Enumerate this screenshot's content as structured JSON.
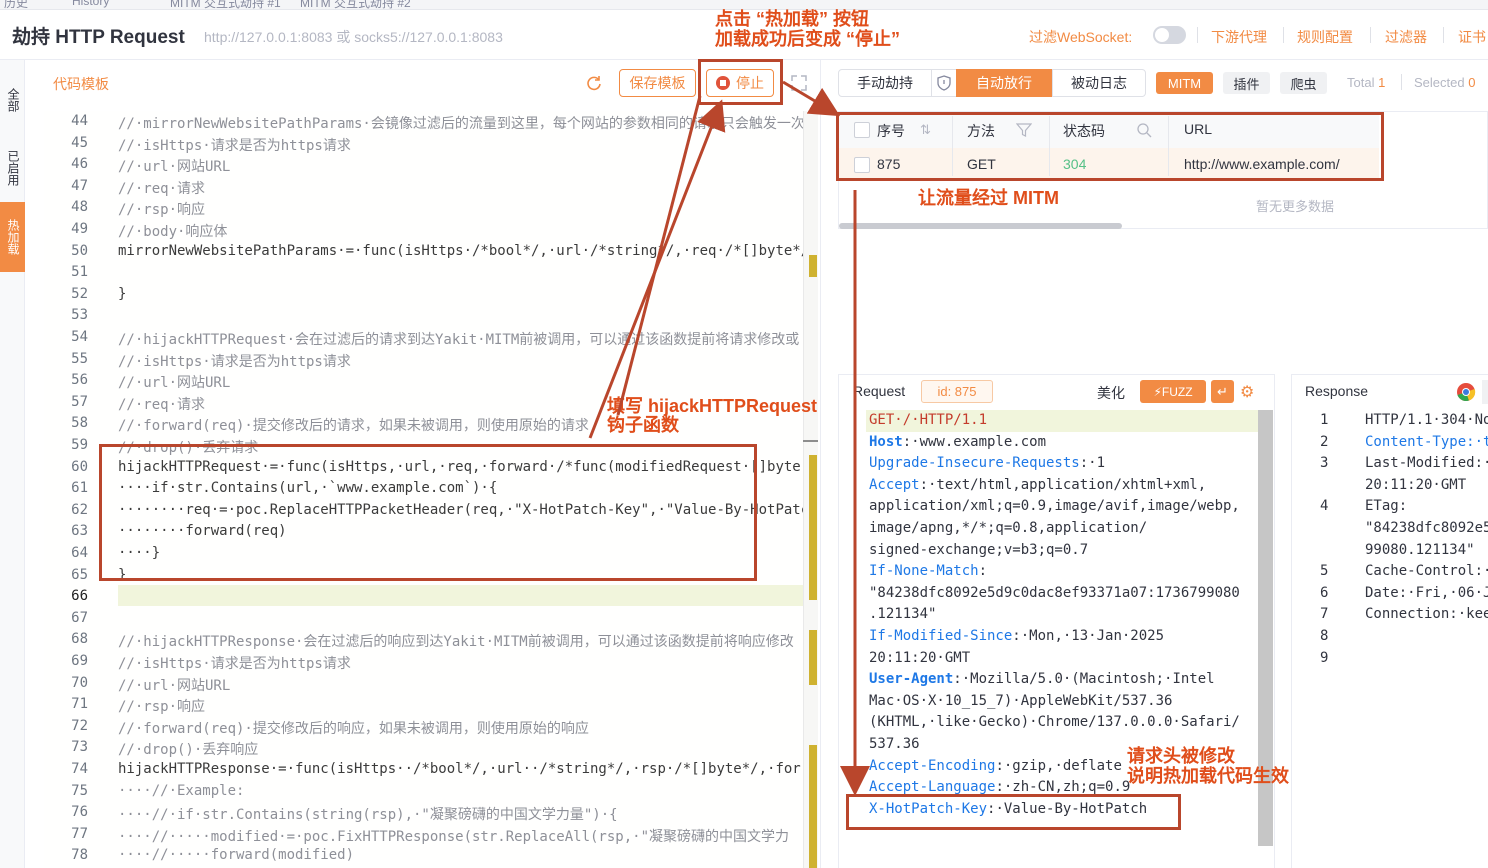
{
  "tabs": [
    "历史",
    "History",
    "MITM 交互式劫持 #1",
    "MITM 交互式劫持 #2"
  ],
  "header": {
    "title": "劫持 HTTP Request",
    "address": "http://127.0.0.1:8083 或 socks5://127.0.0.1:8083",
    "filter_ws_label": "过滤WebSocket:",
    "links": [
      "下游代理",
      "规则配置",
      "过滤器",
      "证书"
    ]
  },
  "side_tabs": [
    "全部",
    "已启用",
    "热加载"
  ],
  "editor": {
    "title": "代码模板",
    "save_label": "保存模板",
    "stop_label": "停止",
    "lines": [
      {
        "n": "44",
        "t": "//·mirrorNewWebsitePathParams·会镜像过滤后的流量到这里，每个网站的参数相同的请求只会触发一次",
        "c": "cmt"
      },
      {
        "n": "45",
        "t": "//·isHttps·请求是否为https请求",
        "c": "cmt"
      },
      {
        "n": "46",
        "t": "//·url·网站URL",
        "c": "cmt"
      },
      {
        "n": "47",
        "t": "//·req·请求",
        "c": "cmt"
      },
      {
        "n": "48",
        "t": "//·rsp·响应",
        "c": "cmt"
      },
      {
        "n": "49",
        "t": "//·body·响应体",
        "c": "cmt"
      },
      {
        "n": "50",
        "t": "mirrorNewWebsitePathParams·=·func(isHttps·/*bool*/,·url·/*string*/,·req·/*[]byte*/",
        "c": "code"
      },
      {
        "n": "51",
        "t": "",
        "c": "code"
      },
      {
        "n": "52",
        "t": "}",
        "c": "code"
      },
      {
        "n": "53",
        "t": "",
        "c": "code"
      },
      {
        "n": "54",
        "t": "//·hijackHTTPRequest·会在过滤后的请求到达Yakit·MITM前被调用，可以通过该函数提前将请求修改或",
        "c": "cmt"
      },
      {
        "n": "55",
        "t": "//·isHttps·请求是否为https请求",
        "c": "cmt"
      },
      {
        "n": "56",
        "t": "//·url·网站URL",
        "c": "cmt"
      },
      {
        "n": "57",
        "t": "//·req·请求",
        "c": "cmt"
      },
      {
        "n": "58",
        "t": "//·forward(req)·提交修改后的请求，如果未被调用，则使用原始的请求",
        "c": "cmt"
      },
      {
        "n": "59",
        "t": "//·drop()·丢弃请求",
        "c": "cmt"
      },
      {
        "n": "60",
        "t": "hijackHTTPRequest·=·func(isHttps,·url,·req,·forward·/*func(modifiedRequest·[]byte",
        "c": "code"
      },
      {
        "n": "61",
        "t": "····if·str.Contains(url,·`www.example.com`)·{",
        "c": "code"
      },
      {
        "n": "62",
        "t": "········req·=·poc.ReplaceHTTPPacketHeader(req,·\"X-HotPatch-Key\",·\"Value-By-HotPatch",
        "c": "code"
      },
      {
        "n": "63",
        "t": "········forward(req)",
        "c": "code"
      },
      {
        "n": "64",
        "t": "····}",
        "c": "code"
      },
      {
        "n": "65",
        "t": "}",
        "c": "code"
      },
      {
        "n": "66",
        "t": "",
        "c": "code"
      },
      {
        "n": "67",
        "t": "",
        "c": "code"
      },
      {
        "n": "68",
        "t": "//·hijackHTTPResponse·会在过滤后的响应到达Yakit·MITM前被调用，可以通过该函数提前将响应修改",
        "c": "cmt"
      },
      {
        "n": "69",
        "t": "//·isHttps·请求是否为https请求",
        "c": "cmt"
      },
      {
        "n": "70",
        "t": "//·url·网站URL",
        "c": "cmt"
      },
      {
        "n": "71",
        "t": "//·rsp·响应",
        "c": "cmt"
      },
      {
        "n": "72",
        "t": "//·forward(req)·提交修改后的响应，如果未被调用，则使用原始的响应",
        "c": "cmt"
      },
      {
        "n": "73",
        "t": "//·drop()·丢弃响应",
        "c": "cmt"
      },
      {
        "n": "74",
        "t": "hijackHTTPResponse·=·func(isHttps··/*bool*/,·url··/*string*/,·rsp·/*[]byte*/,·for",
        "c": "code"
      },
      {
        "n": "75",
        "t": "····//·Example:",
        "c": "cmt"
      },
      {
        "n": "76",
        "t": "····//·if·str.Contains(string(rsp),·\"凝聚磅礴的中国文学力量\")·{",
        "c": "cmt"
      },
      {
        "n": "77",
        "t": "····//·····modified·=·poc.FixHTTPResponse(str.ReplaceAll(rsp,·\"凝聚磅礴的中国文学力",
        "c": "cmt"
      },
      {
        "n": "78",
        "t": "····//·····forward(modified)",
        "c": "cmt"
      }
    ]
  },
  "mitm": {
    "tabs": [
      "手动劫持",
      "自动放行",
      "被动日志"
    ],
    "tags": [
      "MITM",
      "插件",
      "爬虫"
    ],
    "total_label": "Total",
    "total": "1",
    "selected_label": "Selected",
    "selected": "0",
    "columns": [
      "序号",
      "方法",
      "状态码",
      "URL"
    ],
    "rows": [
      {
        "id": "875",
        "method": "GET",
        "status": "304",
        "url": "http://www.example.com/"
      }
    ],
    "empty_text": "暂无更多数据"
  },
  "request": {
    "title": "Request",
    "id_label": "id: 875",
    "beautify_label": "美化",
    "fuzz_label": "FUZZ",
    "lines": [
      {
        "k": "GET·/·HTTP/1.1",
        "v": ""
      },
      {
        "k": "Host",
        "v": ":·www.example.com"
      },
      {
        "k": "Upgrade-Insecure-Requests",
        "v": ":·1"
      },
      {
        "k": "Accept",
        "v": ":·text/html,application/xhtml+xml,"
      },
      {
        "k": "",
        "v": "application/xml;q=0.9,image/avif,image/webp,"
      },
      {
        "k": "",
        "v": "image/apng,*/*;q=0.8,application/"
      },
      {
        "k": "",
        "v": "signed-exchange;v=b3;q=0.7"
      },
      {
        "k": "If-None-Match",
        "v": ":"
      },
      {
        "k": "",
        "v": "\"84238dfc8092e5d9c0dac8ef93371a07:1736799080"
      },
      {
        "k": "",
        "v": ".121134\""
      },
      {
        "k": "If-Modified-Since",
        "v": ":·Mon,·13·Jan·2025"
      },
      {
        "k": "",
        "v": "20:11:20·GMT"
      },
      {
        "k": "User-Agent",
        "v": ":·Mozilla/5.0·(Macintosh;·Intel"
      },
      {
        "k": "",
        "v": "Mac·OS·X·10_15_7)·AppleWebKit/537.36"
      },
      {
        "k": "",
        "v": "(KHTML,·like·Gecko)·Chrome/137.0.0.0·Safari/"
      },
      {
        "k": "",
        "v": "537.36"
      },
      {
        "k": "Accept-Encoding",
        "v": ":·gzip,·deflate"
      },
      {
        "k": "Accept-Language",
        "v": ":·zh-CN,zh;q=0.9"
      },
      {
        "k": "X-HotPatch-Key",
        "v": ":·Value-By-HotPatch"
      }
    ]
  },
  "response": {
    "title": "Response",
    "lines": [
      {
        "n": "1",
        "t": "HTTP/1.1·304·Not"
      },
      {
        "n": "2",
        "t": "Content-Type:·te"
      },
      {
        "n": "3",
        "t": "Last-Modified:·Mo"
      },
      {
        "n": "",
        "t": "20:11:20·GMT"
      },
      {
        "n": "4",
        "t": "ETag:"
      },
      {
        "n": "",
        "t": "\"84238dfc8092e5"
      },
      {
        "n": "",
        "t": "99080.121134\""
      },
      {
        "n": "5",
        "t": "Cache-Control:·ma"
      },
      {
        "n": "6",
        "t": "Date:·Fri,·06·Ju"
      },
      {
        "n": "7",
        "t": "Connection:·kee"
      },
      {
        "n": "8",
        "t": ""
      },
      {
        "n": "9",
        "t": ""
      }
    ]
  },
  "annotations": {
    "top_line1": "点击 “热加载” 按钮",
    "top_line2": "加载成功后变成 “停止”",
    "hook_line1": "填写 hijackHTTPRequest",
    "hook_line2": "钩子函数",
    "mitm": "让流量经过 MITM",
    "header_line1": "请求头被修改",
    "header_line2": "说明热加载代码生效"
  }
}
